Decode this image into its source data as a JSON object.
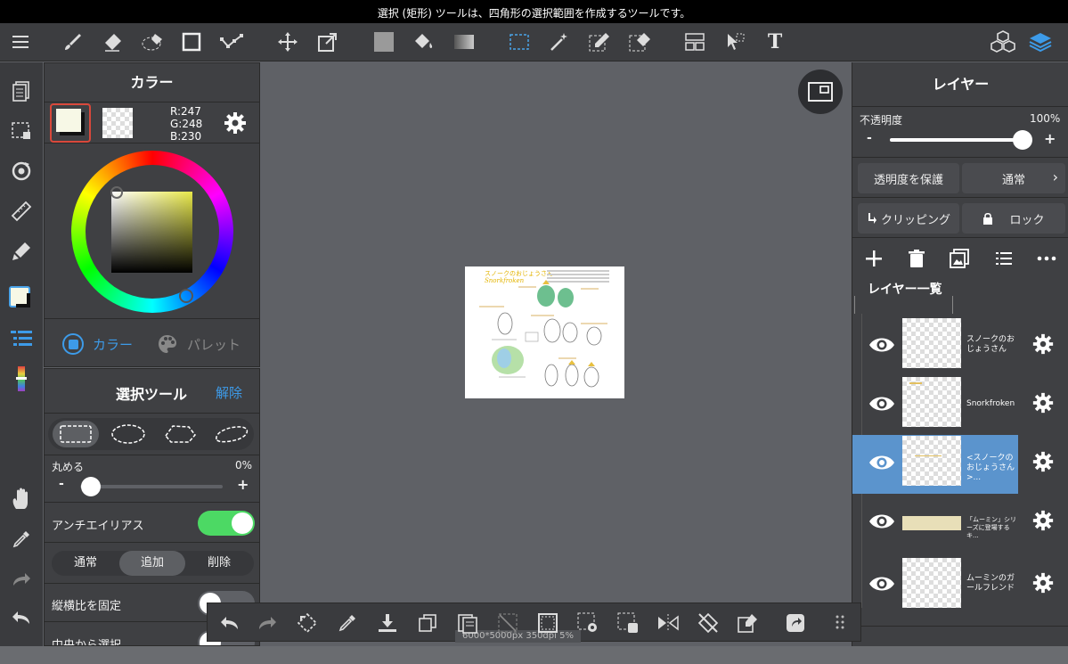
{
  "status_bar": {
    "message": "選択 (矩形) ツールは、四角形の選択範囲を作成するツールです。"
  },
  "toolbar": {
    "menu_icon": "menu-icon",
    "tools": [
      "brush",
      "eraser",
      "lasso-eraser",
      "rectangle",
      "polyline",
      "move",
      "transform",
      "fill-color",
      "bucket",
      "gradient",
      "rect-select",
      "magic-wand",
      "select-pen",
      "select-eraser",
      "frame",
      "operation",
      "text"
    ],
    "right_tools": [
      "material",
      "layers"
    ],
    "text_tool_glyph": "T"
  },
  "color_panel": {
    "title": "カラー",
    "rgb": {
      "r": "R:247",
      "g": "G:248",
      "b": "B:230"
    },
    "main_color": "#f7f8e6",
    "hue_color": "#e8e84a",
    "tabs": {
      "color": "カラー",
      "palette": "パレット"
    }
  },
  "select_panel": {
    "title": "選択ツール",
    "clear": "解除",
    "round_label": "丸める",
    "round_value": "0%",
    "minus": "-",
    "plus": "+",
    "round_level": 0,
    "antialias_label": "アンチエイリアス",
    "antialias_on": true,
    "modes": [
      "通常",
      "追加",
      "削除"
    ],
    "active_mode": "追加",
    "fix_ratio_label": "縦横比を固定",
    "from_center_label": "中央から選択"
  },
  "canvas": {
    "info": "6000*5000px 350dpi 5%",
    "artwork": {
      "heading": "スノークのおじょうさん",
      "heading_en": "Snorkfroken"
    }
  },
  "layer_panel": {
    "title": "レイヤー",
    "opacity_label": "不透明度",
    "opacity_value": "100%",
    "opacity_level": 1.0,
    "minus": "-",
    "plus": "+",
    "protect_alpha": "透明度を保護",
    "blend_mode": "通常",
    "clipping": "クリッピング",
    "lock": "ロック",
    "list_title": "レイヤー一覧",
    "layers": [
      {
        "name": "スノークのおじょうさん",
        "selected": false
      },
      {
        "name": "Snorkfroken",
        "selected": false
      },
      {
        "name": "<スノークのおじょうさん>...",
        "selected": true
      },
      {
        "name": "「ムーミン」シリーズに登場するキ...",
        "selected": false
      },
      {
        "name": "ムーミンのガールフレンド",
        "selected": false
      }
    ]
  },
  "float_bar": {
    "icons": [
      "undo",
      "redo",
      "rotate",
      "eyedropper",
      "save",
      "copy",
      "paste",
      "clear",
      "select-all",
      "select-settings",
      "selection-transform",
      "flip",
      "rotate-reset",
      "edit",
      "share",
      "more"
    ]
  }
}
